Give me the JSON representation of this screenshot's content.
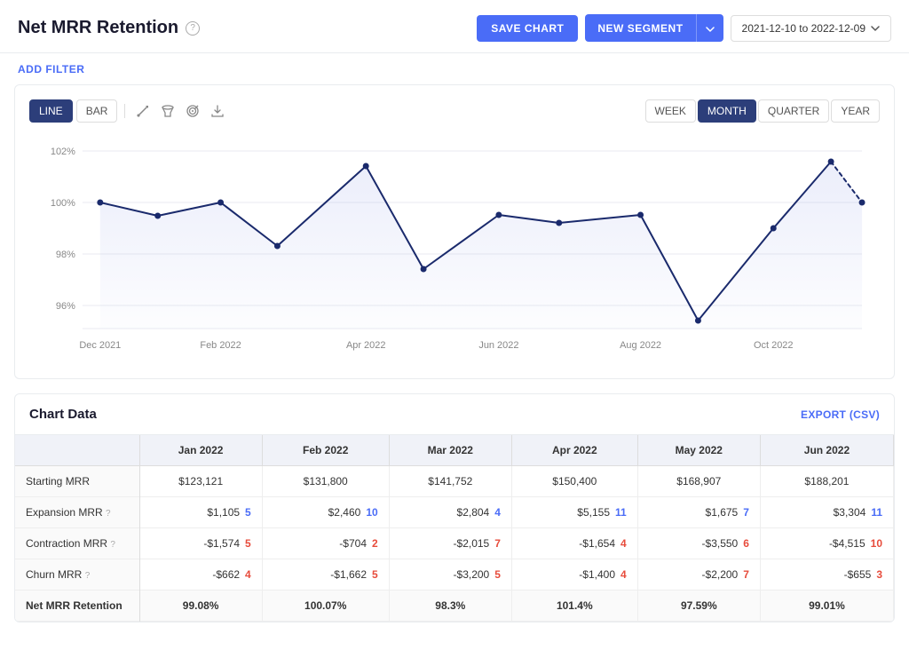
{
  "header": {
    "title": "Net MRR Retention",
    "save_label": "SAVE CHART",
    "new_segment_label": "NEW SEGMENT",
    "date_range": "2021-12-10 to 2022-12-09"
  },
  "filter": {
    "add_label": "ADD FILTER"
  },
  "chart": {
    "types": [
      "LINE",
      "BAR"
    ],
    "active_type": "LINE",
    "periods": [
      "WEEK",
      "MONTH",
      "QUARTER",
      "YEAR"
    ],
    "active_period": "MONTH",
    "y_labels": [
      "102%",
      "100%",
      "98%",
      "96%"
    ],
    "x_labels": [
      "Dec 2021",
      "Feb 2022",
      "Apr 2022",
      "Jun 2022",
      "Aug 2022",
      "Oct 2022"
    ]
  },
  "table": {
    "title": "Chart Data",
    "export_label": "EXPORT (CSV)",
    "columns": [
      "",
      "Jan 2022",
      "Feb 2022",
      "Mar 2022",
      "Apr 2022",
      "May 2022",
      "Jun 2022"
    ],
    "rows": [
      {
        "label": "Starting MRR",
        "values": [
          "$123,121",
          "$131,800",
          "$141,752",
          "$150,400",
          "$168,907",
          "$188,201"
        ],
        "badges": [
          null,
          null,
          null,
          null,
          null,
          null
        ]
      },
      {
        "label": "Expansion MRR",
        "values": [
          "$1,105",
          "$2,460",
          "$2,804",
          "$5,155",
          "$1,675",
          "$3,304"
        ],
        "badges": [
          "5",
          "10",
          "4",
          "11",
          "7",
          "11"
        ],
        "badge_type": "blue"
      },
      {
        "label": "Contraction MRR",
        "values": [
          "-$1,574",
          "-$704",
          "-$2,015",
          "-$1,654",
          "-$3,550",
          "-$4,515"
        ],
        "badges": [
          "5",
          "2",
          "7",
          "4",
          "6",
          "10"
        ],
        "badge_type": "red"
      },
      {
        "label": "Churn MRR",
        "values": [
          "-$662",
          "-$1,662",
          "-$3,200",
          "-$1,400",
          "-$2,200",
          "-$655"
        ],
        "badges": [
          "4",
          "5",
          "5",
          "4",
          "7",
          "3"
        ],
        "badge_type": "red"
      },
      {
        "label": "Net MRR Retention",
        "values": [
          "99.08%",
          "100.07%",
          "98.3%",
          "101.4%",
          "97.59%",
          "99.01%"
        ],
        "badges": [
          null,
          null,
          null,
          null,
          null,
          null
        ]
      }
    ]
  },
  "colors": {
    "accent": "#4a6cf7",
    "active_btn": "#2c3e7a",
    "line": "#1a2a6c",
    "chart_fill": "rgba(100,120,200,0.08)"
  }
}
